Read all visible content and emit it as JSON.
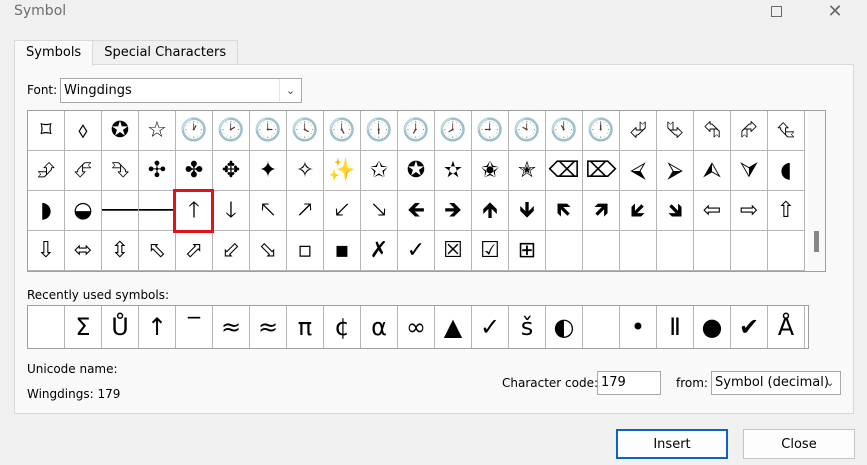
{
  "window": {
    "title": "Symbol",
    "maximize_icon": "maximize-icon",
    "close_icon": "close-icon",
    "close_glyph": "✕"
  },
  "tabs": [
    {
      "label": "Symbols",
      "active": true
    },
    {
      "label": "Special Characters",
      "active": false
    }
  ],
  "font": {
    "label": "Font:",
    "value": "Wingdings"
  },
  "symbol_grid": [
    "⌑",
    "⬨",
    "✪",
    "☆",
    "🕐",
    "🕑",
    "🕒",
    "🕓",
    "🕔",
    "🕕",
    "🕖",
    "🕗",
    "🕘",
    "🕙",
    "🕚",
    "🕛",
    "⮰",
    "⮱",
    "⮲",
    "⮳",
    "⮴",
    "⮵",
    "⮶",
    "⮷",
    "✣",
    "✤",
    "✥",
    "✦",
    "✧",
    "✨",
    "✩",
    "✪",
    "✫",
    "✬",
    "✭",
    "⌫",
    "⌦",
    "⮘",
    "⮚",
    "⮙",
    "⮛",
    "◖",
    "◗",
    "◒",
    "🡐",
    "🡒",
    "🡑",
    "🡓",
    "🡔",
    "🡕",
    "🡗",
    "🡖",
    "🡸",
    "🡺",
    "🡹",
    "🡻",
    "🡼",
    "🡽",
    "🡿",
    "🡾",
    "⇦",
    "⇨",
    "⇧",
    "⇩",
    "⬄",
    "⇳",
    "⬁",
    "⬀",
    "⬃",
    "⬂",
    "▫",
    "▪",
    "✗",
    "✓",
    "☒",
    "☑",
    "⊞",
    "",
    "",
    "",
    "",
    "",
    "",
    "",
    ""
  ],
  "selected_index": 46,
  "recent": {
    "label": "Recently used symbols:",
    "symbols": [
      "",
      "Σ",
      "Ů",
      "↑",
      "‾",
      "≈",
      "≈",
      "π",
      "¢",
      "α",
      "∞",
      "▲",
      "✓",
      "š",
      "◐",
      "",
      "•",
      "Ⅱ",
      "●",
      "✔",
      "Å"
    ]
  },
  "unicode": {
    "label": "Unicode name:",
    "value": "Wingdings: 179"
  },
  "character_code": {
    "label": "Character code:",
    "value": "179"
  },
  "from": {
    "label": "from:",
    "value": "Symbol (decimal)"
  },
  "buttons": {
    "insert": "Insert",
    "close": "Close"
  }
}
